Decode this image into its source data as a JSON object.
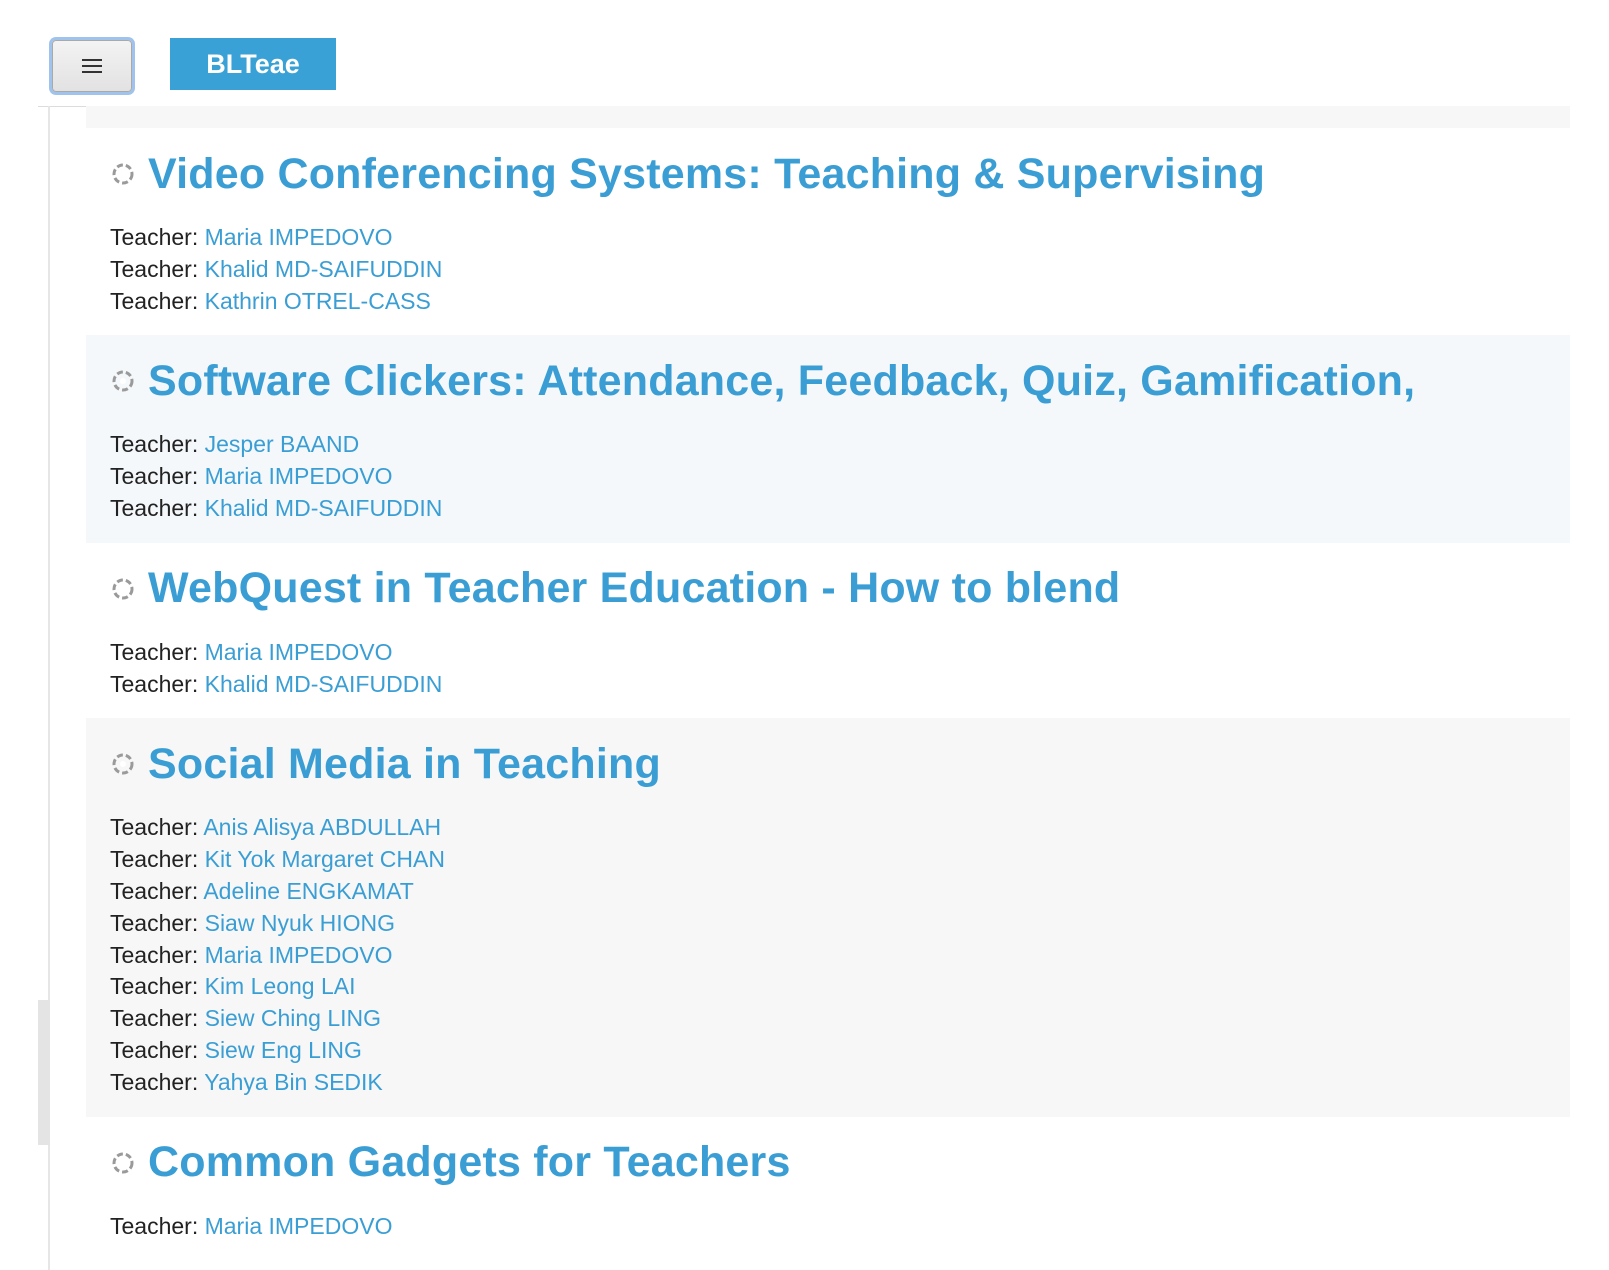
{
  "header": {
    "menu_button_icon": "hamburger-icon",
    "brand_label": "BLTeae"
  },
  "colors": {
    "accent": "#3aa1d6",
    "link": "#3a9ed4",
    "row_alt_blue": "#f4f8fb",
    "row_alt_grey": "#f7f7f7"
  },
  "courses": [
    {
      "icon": "course-icon",
      "title": "Video Conferencing Systems: Teaching & Supervising",
      "teachers": [
        {
          "label": "Teacher:",
          "name": "Maria IMPEDOVO"
        },
        {
          "label": "Teacher:",
          "name": "Khalid MD-SAIFUDDIN"
        },
        {
          "label": "Teacher:",
          "name": "Kathrin OTREL-CASS"
        }
      ]
    },
    {
      "icon": "course-icon",
      "title": "Software Clickers: Attendance, Feedback, Quiz, Gamification,",
      "teachers": [
        {
          "label": "Teacher:",
          "name": "Jesper BAAND"
        },
        {
          "label": "Teacher:",
          "name": "Maria IMPEDOVO"
        },
        {
          "label": "Teacher:",
          "name": "Khalid MD-SAIFUDDIN"
        }
      ]
    },
    {
      "icon": "course-icon",
      "title": "WebQuest in Teacher Education - How to blend",
      "teachers": [
        {
          "label": "Teacher:",
          "name": "Maria IMPEDOVO"
        },
        {
          "label": "Teacher:",
          "name": "Khalid MD-SAIFUDDIN"
        }
      ]
    },
    {
      "icon": "course-icon",
      "title": "Social Media in Teaching",
      "teachers": [
        {
          "label": "Teacher:",
          "name": "Anis Alisya ABDULLAH"
        },
        {
          "label": "Teacher:",
          "name": "Kit Yok Margaret CHAN"
        },
        {
          "label": "Teacher:",
          "name": "Adeline ENGKAMAT"
        },
        {
          "label": "Teacher:",
          "name": "Siaw Nyuk HIONG"
        },
        {
          "label": "Teacher:",
          "name": "Maria IMPEDOVO"
        },
        {
          "label": "Teacher:",
          "name": "Kim Leong LAI"
        },
        {
          "label": "Teacher:",
          "name": "Siew Ching LING"
        },
        {
          "label": "Teacher:",
          "name": "Siew Eng LING"
        },
        {
          "label": "Teacher:",
          "name": "Yahya Bin SEDIK"
        }
      ]
    },
    {
      "icon": "course-icon",
      "title": "Common Gadgets for Teachers",
      "teachers": [
        {
          "label": "Teacher:",
          "name": "Maria IMPEDOVO"
        }
      ]
    }
  ]
}
